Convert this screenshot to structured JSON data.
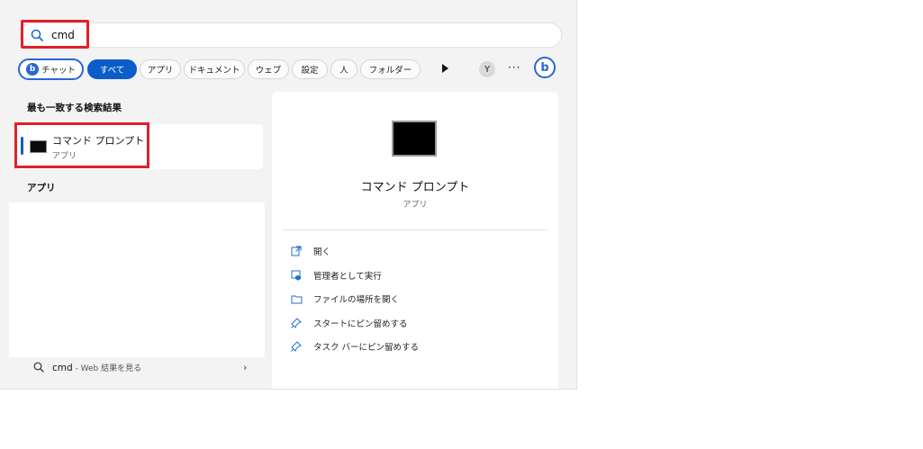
{
  "search": {
    "value": "cmd"
  },
  "chips": [
    {
      "label": "チャット"
    },
    {
      "label": "すべて"
    },
    {
      "label": "アプリ"
    },
    {
      "label": "ドキュメント"
    },
    {
      "label": "ウェブ"
    },
    {
      "label": "設定"
    },
    {
      "label": "人"
    },
    {
      "label": "フォルダー"
    }
  ],
  "user": {
    "avatar_letter": "Y"
  },
  "more_label": "···",
  "left": {
    "best_match_title": "最も一致する検索結果",
    "best_match": {
      "name": "コマンド プロンプト",
      "type": "アプリ"
    },
    "apps_title": "アプリ",
    "web": {
      "query": "cmd",
      "suffix": " - Web 結果を見る"
    }
  },
  "detail": {
    "title": "コマンド プロンプト",
    "subtitle": "アプリ",
    "actions": [
      {
        "label": "開く",
        "icon": "open-external-icon"
      },
      {
        "label": "管理者として実行",
        "icon": "admin-shield-icon"
      },
      {
        "label": "ファイルの場所を開く",
        "icon": "folder-icon"
      },
      {
        "label": "スタートにピン留めする",
        "icon": "pin-icon"
      },
      {
        "label": "タスク バーにピン留めする",
        "icon": "pin-icon"
      }
    ]
  },
  "colors": {
    "accent": "#0b5ec9",
    "highlight": "#e0202a",
    "bing": "#2a66d6"
  }
}
